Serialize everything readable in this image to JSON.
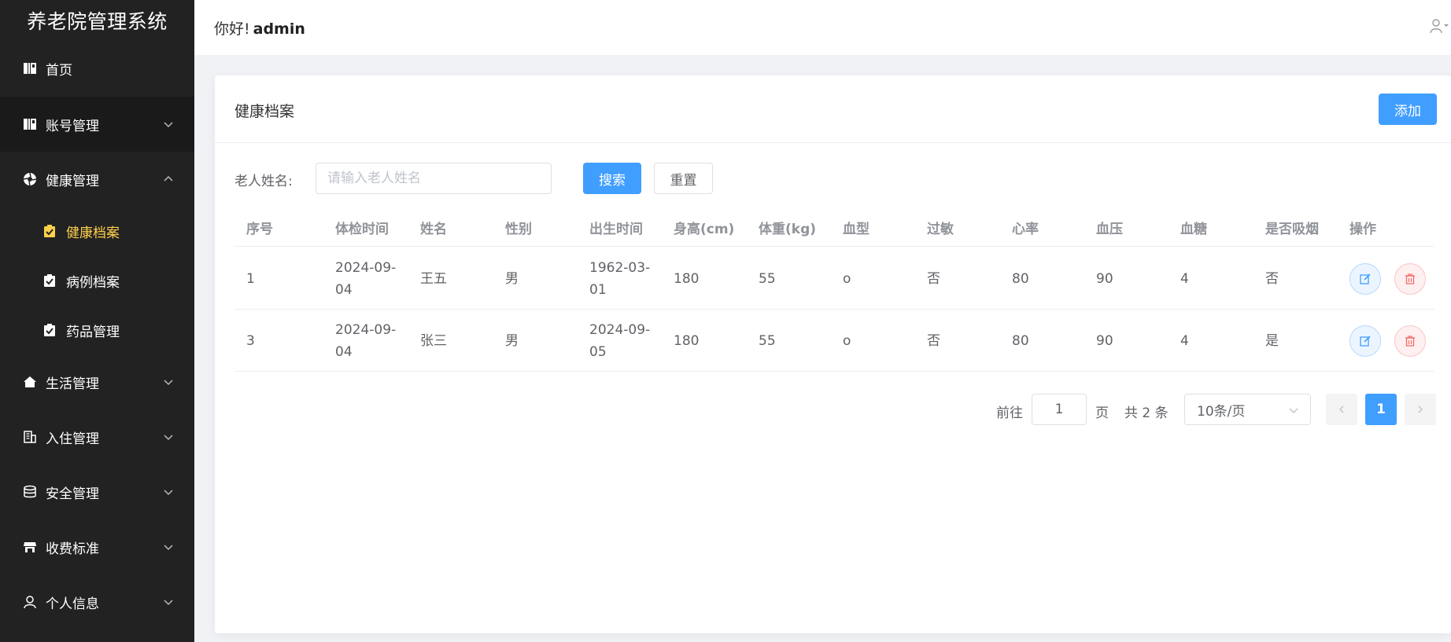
{
  "sidebar": {
    "title": "养老院管理系统",
    "items": [
      {
        "label": "首页",
        "icon": "book-icon"
      },
      {
        "label": "账号管理",
        "icon": "book-icon"
      },
      {
        "label": "健康管理",
        "icon": "aperture-icon"
      },
      {
        "label": "生活管理",
        "icon": "home-icon"
      },
      {
        "label": "入住管理",
        "icon": "office-building-icon"
      },
      {
        "label": "安全管理",
        "icon": "database-icon"
      },
      {
        "label": "收费标准",
        "icon": "shop-icon"
      },
      {
        "label": "个人信息",
        "icon": "user-icon"
      }
    ],
    "sub_items": [
      {
        "label": "健康档案",
        "icon": "checklist-icon",
        "active": true
      },
      {
        "label": "病例档案",
        "icon": "checklist-icon",
        "active": false
      },
      {
        "label": "药品管理",
        "icon": "checklist-icon",
        "active": false
      }
    ],
    "active_color": "#ffd04b",
    "bg_color": "#222222"
  },
  "header": {
    "greeting": "你好!",
    "username": "admin"
  },
  "card": {
    "title": "健康档案",
    "add_label": "添加"
  },
  "search": {
    "label": "老人姓名:",
    "placeholder": "请输入老人姓名",
    "value": "",
    "search_label": "搜索",
    "reset_label": "重置"
  },
  "table": {
    "columns": [
      "序号",
      "体检时间",
      "姓名",
      "性别",
      "出生时间",
      "身高(cm)",
      "体重(kg)",
      "血型",
      "过敏",
      "心率",
      "血压",
      "血糖",
      "是否吸烟",
      "操作"
    ],
    "rows": [
      {
        "id": "1",
        "check_date": "2024-09-04",
        "name": "王五",
        "gender": "男",
        "birth": "1962-03-01",
        "height": "180",
        "weight": "55",
        "blood_type": "o",
        "allergy": "否",
        "heart_rate": "80",
        "blood_pressure": "90",
        "blood_sugar": "4",
        "smoker": "否"
      },
      {
        "id": "3",
        "check_date": "2024-09-04",
        "name": "张三",
        "gender": "男",
        "birth": "2024-09-05",
        "height": "180",
        "weight": "55",
        "blood_type": "o",
        "allergy": "否",
        "heart_rate": "80",
        "blood_pressure": "90",
        "blood_sugar": "4",
        "smoker": "是"
      }
    ]
  },
  "pagination": {
    "goto_label": "前往",
    "goto_value": "1",
    "page_unit": "页",
    "total_text": "共 2 条",
    "page_size": "10条/页",
    "current_page": "1"
  },
  "colors": {
    "primary": "#409eff",
    "danger": "#f56c6c"
  }
}
